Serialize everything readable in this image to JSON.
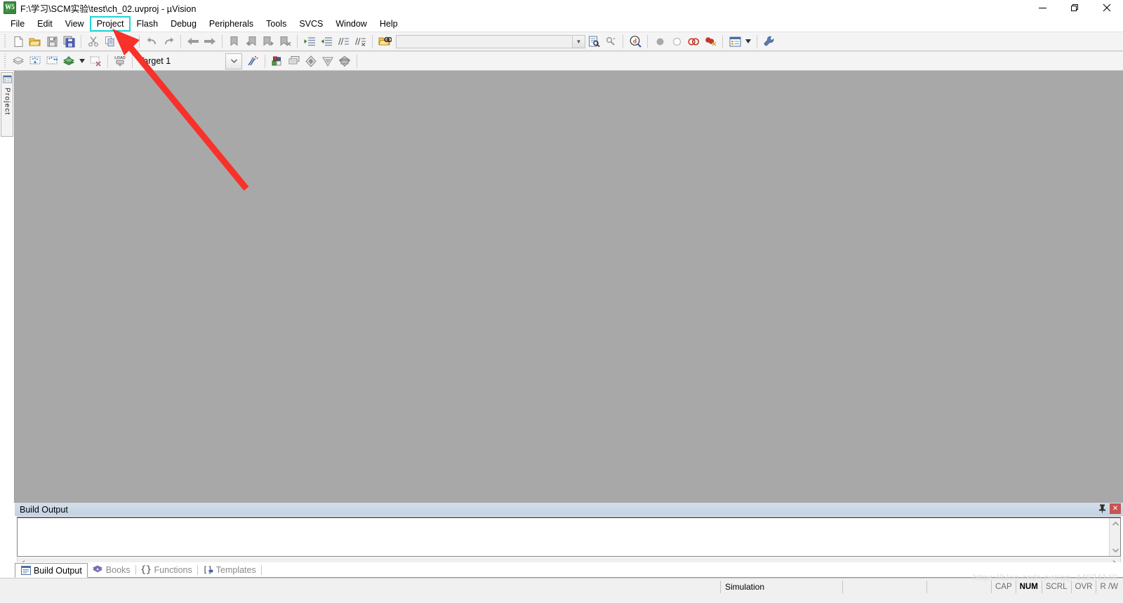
{
  "window": {
    "title": "F:\\学习\\SCM实验\\test\\ch_02.uvproj - µVision",
    "app_icon": "uvision-logo-icon",
    "controls": {
      "minimize": "minimize-icon",
      "maximize": "restore-icon",
      "close": "close-icon"
    }
  },
  "menubar": {
    "items": [
      {
        "label": "File"
      },
      {
        "label": "Edit"
      },
      {
        "label": "View"
      },
      {
        "label": "Project"
      },
      {
        "label": "Flash"
      },
      {
        "label": "Debug"
      },
      {
        "label": "Peripherals"
      },
      {
        "label": "Tools"
      },
      {
        "label": "SVCS"
      },
      {
        "label": "Window"
      },
      {
        "label": "Help"
      }
    ],
    "highlighted_item": "Project",
    "highlight_color": "#21d4d4"
  },
  "toolbar_file": {
    "buttons": [
      {
        "name": "new-file-icon",
        "title": "New"
      },
      {
        "name": "open-file-icon",
        "title": "Open"
      },
      {
        "name": "save-icon",
        "title": "Save"
      },
      {
        "name": "save-all-icon",
        "title": "Save All"
      },
      {
        "name": "cut-icon",
        "title": "Cut"
      },
      {
        "name": "copy-icon",
        "title": "Copy"
      },
      {
        "name": "paste-icon",
        "title": "Paste"
      },
      {
        "name": "undo-icon",
        "title": "Undo"
      },
      {
        "name": "redo-icon",
        "title": "Redo"
      },
      {
        "name": "navigate-back-icon",
        "title": "Back"
      },
      {
        "name": "navigate-forward-icon",
        "title": "Forward"
      },
      {
        "name": "bookmark-toggle-icon",
        "title": "Insert/Remove Bookmark"
      },
      {
        "name": "bookmark-prev-icon",
        "title": "Previous Bookmark"
      },
      {
        "name": "bookmark-next-icon",
        "title": "Next Bookmark"
      },
      {
        "name": "bookmark-clear-icon",
        "title": "Clear All Bookmarks"
      },
      {
        "name": "indent-right-icon",
        "title": "Indent"
      },
      {
        "name": "indent-left-icon",
        "title": "Outdent"
      },
      {
        "name": "comment-icon",
        "title": "Comment"
      },
      {
        "name": "uncomment-icon",
        "title": "Uncomment"
      },
      {
        "name": "find-in-files-icon",
        "title": "Find in Files"
      },
      {
        "name": "find-icon",
        "title": "Find"
      },
      {
        "name": "incremental-find-icon",
        "title": "Incremental Find"
      },
      {
        "name": "debug-session-icon",
        "title": "Start/Stop Debug Session"
      },
      {
        "name": "breakpoint-insert-icon",
        "title": "Insert/Remove Breakpoint"
      },
      {
        "name": "breakpoint-enable-icon",
        "title": "Enable/Disable Breakpoint"
      },
      {
        "name": "breakpoint-disable-all-icon",
        "title": "Disable All Breakpoints"
      },
      {
        "name": "breakpoint-kill-all-icon",
        "title": "Kill All Breakpoints"
      },
      {
        "name": "project-window-icon",
        "title": "Project Window"
      },
      {
        "name": "configure-icon",
        "title": "Configuration Wizard"
      }
    ],
    "search_box": {
      "value": "",
      "placeholder": ""
    }
  },
  "toolbar_build": {
    "buttons": [
      {
        "name": "translate-icon",
        "title": "Translate Current File"
      },
      {
        "name": "build-icon",
        "title": "Build"
      },
      {
        "name": "rebuild-icon",
        "title": "Rebuild All"
      },
      {
        "name": "batch-build-icon",
        "title": "Batch Build"
      },
      {
        "name": "stop-build-icon",
        "title": "Stop Build"
      },
      {
        "name": "download-icon",
        "title": "Download"
      },
      {
        "name": "target-options-icon",
        "title": "Options for Target"
      },
      {
        "name": "manage-components-icon",
        "title": "Manage Components"
      },
      {
        "name": "manage-multi-project-icon",
        "title": "Multi-Project"
      },
      {
        "name": "pack-installer-icon",
        "title": "Pack Installer"
      },
      {
        "name": "manage-run-time-icon",
        "title": "Manage Run-Time Environment"
      },
      {
        "name": "select-software-packs-icon",
        "title": "Select Software Packs"
      }
    ],
    "target_select": {
      "value": "Target 1",
      "label": "Target 1"
    }
  },
  "left_dock": {
    "tab_label": "Project",
    "tab_icon": "project-window-icon"
  },
  "editor": {
    "background": "#a8a8a8",
    "content": ""
  },
  "build_output": {
    "title": "Build Output",
    "text": "",
    "pin_icon": "pin-icon",
    "close_icon": "close-icon",
    "scroll_up_icon": "chevron-up-icon",
    "scroll_down_icon": "chevron-down-icon",
    "scroll_left_icon": "chevron-left-icon",
    "scroll_right_icon": "chevron-right-icon"
  },
  "bottom_tabs": {
    "items": [
      {
        "label": "Build Output",
        "icon": "build-output-icon",
        "active": true
      },
      {
        "label": "Books",
        "icon": "books-icon",
        "active": false
      },
      {
        "label": "Functions",
        "icon": "functions-icon",
        "active": false
      },
      {
        "label": "Templates",
        "icon": "templates-icon",
        "active": false
      }
    ]
  },
  "statusbar": {
    "simulation": "Simulation",
    "cell2": "",
    "cell3": "",
    "flags": [
      {
        "label": "CAP",
        "active": false
      },
      {
        "label": "NUM",
        "active": true
      },
      {
        "label": "SCRL",
        "active": false
      },
      {
        "label": "OVR",
        "active": false
      },
      {
        "label": "R /W",
        "active": false
      }
    ]
  },
  "watermark": {
    "text": "https://blog.csdn.net/qq_44824148"
  },
  "annotation": {
    "arrow_color": "#f8312a",
    "arrow_from": "350,268",
    "arrow_to": "163,44"
  }
}
